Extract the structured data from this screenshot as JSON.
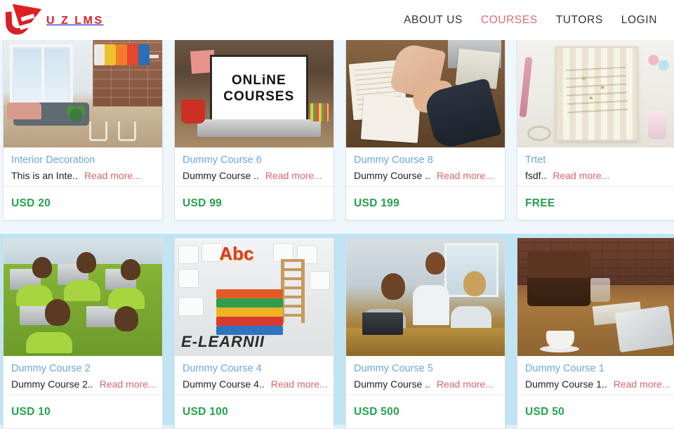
{
  "header": {
    "logo": {
      "icon": "uzlms-logo-icon",
      "text": "U Z LMS"
    },
    "nav": [
      {
        "label": "ABOUT US",
        "active": false,
        "name": "nav-about-us"
      },
      {
        "label": "COURSES",
        "active": true,
        "name": "nav-courses"
      },
      {
        "label": "TUTORS",
        "active": false,
        "name": "nav-tutors"
      },
      {
        "label": "LOGIN",
        "active": false,
        "name": "nav-login"
      }
    ]
  },
  "colors": {
    "brand_red": "#d81f26",
    "nav_active": "#e06a72",
    "title_blue": "#6ba7d6",
    "read_more_red": "#d9656c",
    "price_green": "#22a34a",
    "page_bg_top": "#eef7fc",
    "page_bg_bottom": "#bfe4f4"
  },
  "read_more_label": "Read more...",
  "courses": [
    {
      "title": "Interior Decoration",
      "desc": "This is an Inte..",
      "price": "USD 20",
      "thumb": "interior-room-thumbnail"
    },
    {
      "title": "Dummy Course 6",
      "desc": "Dummy Course ..",
      "price": "USD 99",
      "thumb": "online-courses-laptop-thumbnail"
    },
    {
      "title": "Dummy Course 8",
      "desc": "Dummy Course ..",
      "price": "USD 199",
      "thumb": "handshake-documents-thumbnail"
    },
    {
      "title": "Trtet",
      "desc": "fsdf..",
      "price": "FREE",
      "thumb": "desk-notebook-flatlay-thumbnail"
    },
    {
      "title": "Dummy Course 2",
      "desc": "Dummy Course 2..",
      "price": "USD 10",
      "thumb": "classroom-students-laptops-thumbnail"
    },
    {
      "title": "Dummy Course 4",
      "desc": "Dummy Course 4..",
      "price": "USD 100",
      "thumb": "elearning-books-keyboard-thumbnail"
    },
    {
      "title": "Dummy Course 5",
      "desc": "Dummy Course ..",
      "price": "USD 500",
      "thumb": "students-smiling-desk-thumbnail"
    },
    {
      "title": "Dummy Course 1",
      "desc": "Dummy Course 1..",
      "price": "USD 50",
      "thumb": "bag-coffee-tablet-thumbnail"
    }
  ]
}
